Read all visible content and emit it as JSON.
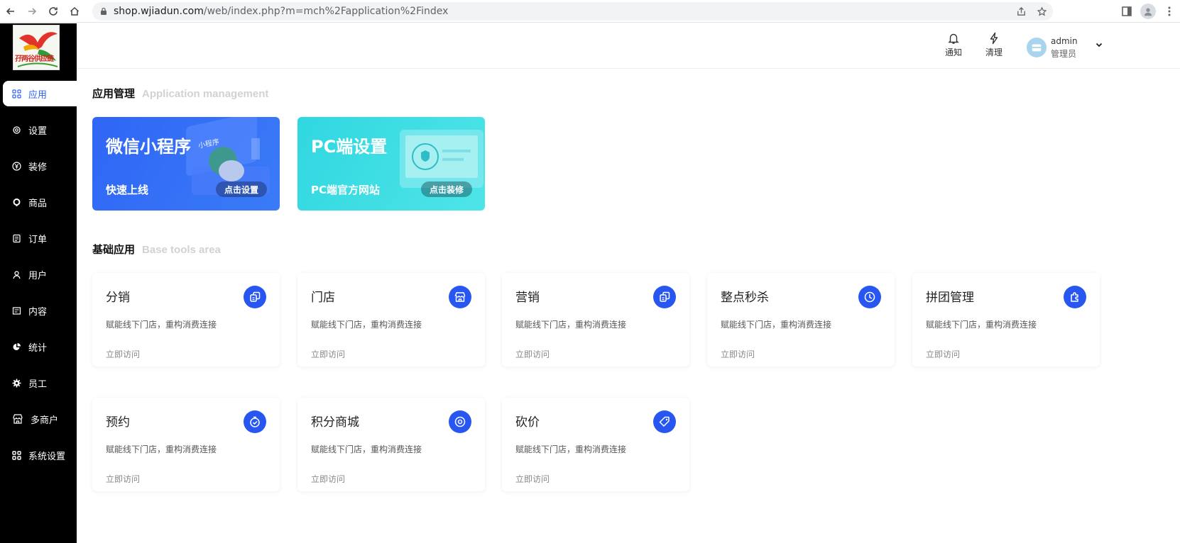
{
  "browser": {
    "url_host": "shop.wjiadun.com",
    "url_path": "/web/index.php?m=mch%2Fapplication%2Findex"
  },
  "sidebar": {
    "logo_text": "孖两谷供应链",
    "items": [
      {
        "label": "应用",
        "icon": "grid-icon",
        "active": true
      },
      {
        "label": "设置",
        "icon": "gear-icon"
      },
      {
        "label": "装修",
        "icon": "yen-icon"
      },
      {
        "label": "商品",
        "icon": "goods-icon"
      },
      {
        "label": "订单",
        "icon": "order-icon"
      },
      {
        "label": "用户",
        "icon": "user-icon"
      },
      {
        "label": "内容",
        "icon": "content-icon"
      },
      {
        "label": "统计",
        "icon": "stats-icon"
      },
      {
        "label": "员工",
        "icon": "cog-icon"
      },
      {
        "label": "多商户",
        "icon": "shop-icon"
      },
      {
        "label": "系统设置",
        "icon": "grid-icon"
      }
    ]
  },
  "header": {
    "notify_label": "通知",
    "clean_label": "清理",
    "username": "admin",
    "role": "管理员"
  },
  "sections": {
    "app_mgmt": {
      "title": "应用管理",
      "subtitle": "Application management"
    },
    "base_tools": {
      "title": "基础应用",
      "subtitle": "Base tools area"
    }
  },
  "banners": [
    {
      "title": "微信小程序",
      "subtitle": "快速上线",
      "button": "点击设置",
      "art_text": "小程序"
    },
    {
      "title": "PC端设置",
      "subtitle": "PC端官方网站",
      "button": "点击装修"
    }
  ],
  "cards": [
    {
      "title": "分销",
      "desc": "赋能线下门店，重构消费连接",
      "link": "立即访问",
      "icon": "copy-icon"
    },
    {
      "title": "门店",
      "desc": "赋能线下门店，重构消费连接",
      "link": "立即访问",
      "icon": "store-icon"
    },
    {
      "title": "营销",
      "desc": "赋能线下门店，重构消费连接",
      "link": "立即访问",
      "icon": "copy-icon"
    },
    {
      "title": "整点秒杀",
      "desc": "赋能线下门店，重构消费连接",
      "link": "立即访问",
      "icon": "clock-icon"
    },
    {
      "title": "拼团管理",
      "desc": "赋能线下门店，重构消费连接",
      "link": "立即访问",
      "icon": "puzzle-icon"
    },
    {
      "title": "预约",
      "desc": "赋能线下门店，重构消费连接",
      "link": "立即访问",
      "icon": "timer-icon"
    },
    {
      "title": "积分商城",
      "desc": "赋能线下门店，重构消费连接",
      "link": "立即访问",
      "icon": "target-icon"
    },
    {
      "title": "砍价",
      "desc": "赋能线下门店，重构消费连接",
      "link": "立即访问",
      "icon": "tag-icon"
    }
  ],
  "colors": {
    "accent": "#2757f0",
    "sidebar_bg": "#000000",
    "banner_blue": "#2f66f5",
    "banner_cyan": "#30d7e0"
  }
}
